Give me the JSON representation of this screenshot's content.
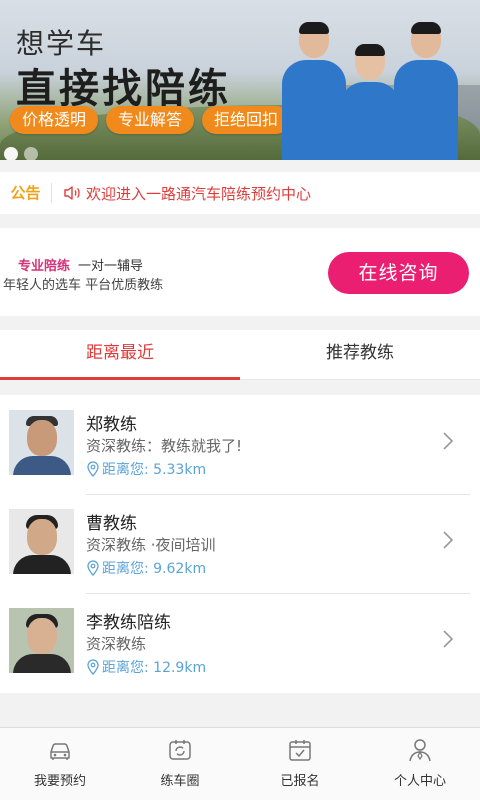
{
  "banner": {
    "line1": "想学车",
    "line2": "直接找陪练",
    "pills": [
      "价格透明",
      "专业解答",
      "拒绝回扣"
    ],
    "slide_count": 2,
    "active_slide": 1
  },
  "notice": {
    "tag": "公告",
    "icon": "speaker-icon",
    "text": "欢迎进入一路通汽车陪练预约中心"
  },
  "consult": {
    "highlight": "专业陪练",
    "subtitle": "一对一辅导",
    "line2": "年轻人的选车  平台优质教练",
    "button_label": "在线咨询"
  },
  "tabs": [
    {
      "label": "距离最近",
      "active": true
    },
    {
      "label": "推荐教练",
      "active": false
    }
  ],
  "coaches": [
    {
      "name": "郑教练",
      "desc": "资深教练：教练就我了!",
      "distance": "距离您: 5.33km"
    },
    {
      "name": "曹教练",
      "desc": "资深教练 ·夜间培训",
      "distance": "距离您: 9.62km"
    },
    {
      "name": "李教练陪练",
      "desc": "资深教练",
      "distance": "距离您: 12.9km"
    }
  ],
  "tabbar": [
    {
      "label": "我要预约",
      "icon": "car-icon"
    },
    {
      "label": "练车圈",
      "icon": "circle-chat-icon"
    },
    {
      "label": "已报名",
      "icon": "calendar-check-icon"
    },
    {
      "label": "个人中心",
      "icon": "user-icon"
    }
  ],
  "colors": {
    "accent_red": "#e03b3b",
    "consult_pink": "#ea1f71",
    "pill_orange": "#f08a1d",
    "notice_tag": "#f0a31a",
    "distance_blue": "#5aa3d8"
  }
}
